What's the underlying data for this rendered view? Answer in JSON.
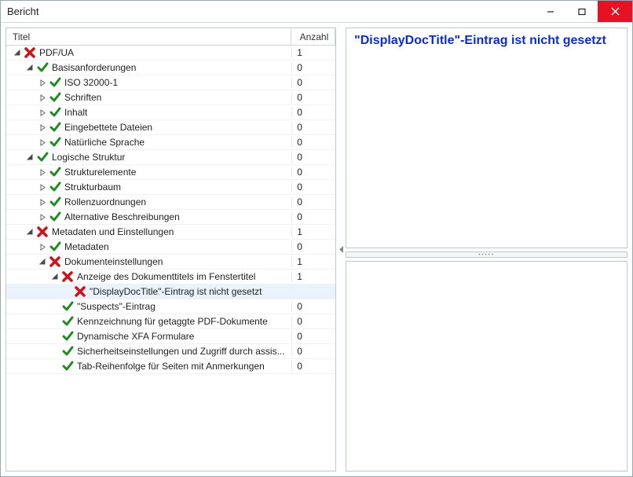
{
  "window": {
    "title": "Bericht"
  },
  "columns": {
    "title": "Titel",
    "count": "Anzahl"
  },
  "detail_message": "\"DisplayDocTitle\"-Eintrag  ist nicht gesetzt",
  "tree": [
    {
      "id": "pdfua",
      "level": 0,
      "expanded": true,
      "status": "fail",
      "label": "PDF/UA",
      "count": "1"
    },
    {
      "id": "basis",
      "level": 1,
      "expanded": true,
      "status": "pass",
      "label": "Basisanforderungen",
      "count": "0"
    },
    {
      "id": "iso",
      "level": 2,
      "expanded": false,
      "status": "pass",
      "label": "ISO 32000-1",
      "count": "0"
    },
    {
      "id": "schriften",
      "level": 2,
      "expanded": false,
      "status": "pass",
      "label": "Schriften",
      "count": "0"
    },
    {
      "id": "inhalt",
      "level": 2,
      "expanded": false,
      "status": "pass",
      "label": "Inhalt",
      "count": "0"
    },
    {
      "id": "embed",
      "level": 2,
      "expanded": false,
      "status": "pass",
      "label": "Eingebettete Dateien",
      "count": "0"
    },
    {
      "id": "lang",
      "level": 2,
      "expanded": false,
      "status": "pass",
      "label": "Natürliche Sprache",
      "count": "0"
    },
    {
      "id": "logik",
      "level": 1,
      "expanded": true,
      "status": "pass",
      "label": "Logische Struktur",
      "count": "0"
    },
    {
      "id": "structel",
      "level": 2,
      "expanded": false,
      "status": "pass",
      "label": "Strukturelemente",
      "count": "0"
    },
    {
      "id": "structtree",
      "level": 2,
      "expanded": false,
      "status": "pass",
      "label": "Strukturbaum",
      "count": "0"
    },
    {
      "id": "roles",
      "level": 2,
      "expanded": false,
      "status": "pass",
      "label": "Rollenzuordnungen",
      "count": "0"
    },
    {
      "id": "altdesc",
      "level": 2,
      "expanded": false,
      "status": "pass",
      "label": "Alternative Beschreibungen",
      "count": "0"
    },
    {
      "id": "metaset",
      "level": 1,
      "expanded": true,
      "status": "fail",
      "label": "Metadaten und Einstellungen",
      "count": "1"
    },
    {
      "id": "metadata",
      "level": 2,
      "expanded": false,
      "status": "pass",
      "label": "Metadaten",
      "count": "0"
    },
    {
      "id": "docset",
      "level": 2,
      "expanded": true,
      "status": "fail",
      "label": "Dokumenteinstellungen",
      "count": "1"
    },
    {
      "id": "anzeige",
      "level": 3,
      "expanded": true,
      "status": "fail",
      "label": "Anzeige des Dokumenttitels im Fenstertitel",
      "count": "1"
    },
    {
      "id": "displaydoctitle",
      "level": 4,
      "expanded": null,
      "status": "fail",
      "label": "\"DisplayDocTitle\"-Eintrag  ist nicht gesetzt",
      "count": "",
      "selected": true
    },
    {
      "id": "suspects",
      "level": 3,
      "expanded": null,
      "status": "pass",
      "label": "\"Suspects\"-Eintrag",
      "count": "0"
    },
    {
      "id": "tagmark",
      "level": 3,
      "expanded": null,
      "status": "pass",
      "label": "Kennzeichnung für getaggte PDF-Dokumente",
      "count": "0"
    },
    {
      "id": "xfa",
      "level": 3,
      "expanded": null,
      "status": "pass",
      "label": "Dynamische XFA Formulare",
      "count": "0"
    },
    {
      "id": "security",
      "level": 3,
      "expanded": null,
      "status": "pass",
      "label": "Sicherheitseinstellungen und Zugriff durch assis...",
      "count": "0"
    },
    {
      "id": "taborder",
      "level": 3,
      "expanded": null,
      "status": "pass",
      "label": "Tab-Reihenfolge für Seiten mit Anmerkungen",
      "count": "0"
    }
  ]
}
